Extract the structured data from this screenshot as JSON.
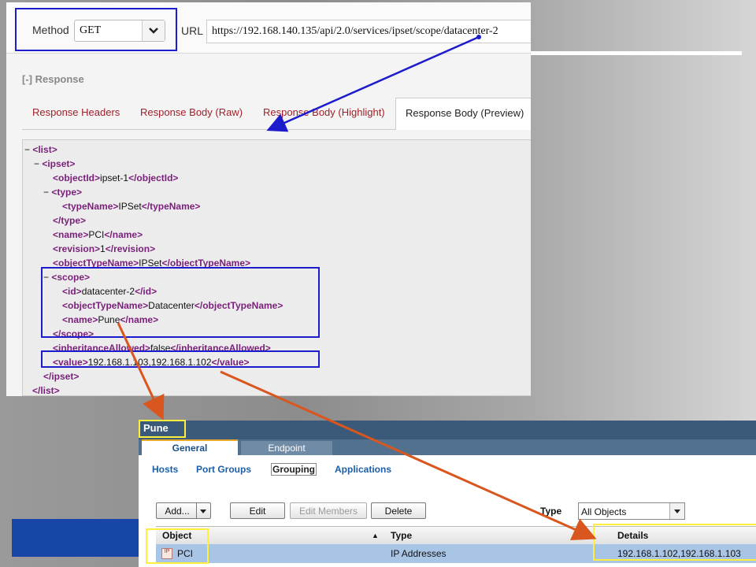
{
  "request": {
    "method_label": "Method",
    "method_value": "GET",
    "url_label": "URL",
    "url_value": "https://192.168.140.135/api/2.0/services/ipset/scope/datacenter-2"
  },
  "response": {
    "section_label": "[-] Response",
    "tabs": [
      {
        "label": "Response Headers"
      },
      {
        "label": "Response Body (Raw)"
      },
      {
        "label": "Response Body (Highlight)"
      },
      {
        "label": "Response Body (Preview)"
      }
    ],
    "xml_lines": [
      {
        "pre": "− ",
        "o": "<list>",
        "t": "",
        "c": ""
      },
      {
        "pre": "− ",
        "o": "<ipset>",
        "t": "",
        "c": ""
      },
      {
        "pre": "",
        "o": "<objectId>",
        "t": "ipset-1",
        "c": "</objectId>"
      },
      {
        "pre": "− ",
        "o": "<type>",
        "t": "",
        "c": ""
      },
      {
        "pre": "",
        "o": "<typeName>",
        "t": "IPSet",
        "c": "</typeName>"
      },
      {
        "pre": "",
        "o": "</type>",
        "t": "",
        "c": ""
      },
      {
        "pre": "",
        "o": "<name>",
        "t": "PCI",
        "c": "</name>"
      },
      {
        "pre": "",
        "o": "<revision>",
        "t": "1",
        "c": "</revision>"
      },
      {
        "pre": "",
        "o": "<objectTypeName>",
        "t": "IPSet",
        "c": "</objectTypeName>"
      },
      {
        "pre": "− ",
        "o": "<scope>",
        "t": "",
        "c": ""
      },
      {
        "pre": "",
        "o": "<id>",
        "t": "datacenter-2",
        "c": "</id>"
      },
      {
        "pre": "",
        "o": "<objectTypeName>",
        "t": "Datacenter",
        "c": "</objectTypeName>"
      },
      {
        "pre": "",
        "o": "<name>",
        "t": "Pune",
        "c": "</name>"
      },
      {
        "pre": "",
        "o": "</scope>",
        "t": "",
        "c": ""
      },
      {
        "pre": "",
        "o": "<inheritanceAllowed>",
        "t": "false",
        "c": "</inheritanceAllowed>"
      },
      {
        "pre": "",
        "o": "<value>",
        "t": "192.168.1.103,192.168.1.102",
        "c": "</value>"
      },
      {
        "pre": "",
        "o": "</ipset>",
        "t": "",
        "c": ""
      },
      {
        "pre": "",
        "o": "</list>",
        "t": "",
        "c": ""
      }
    ]
  },
  "vsphere": {
    "object_title": "Pune",
    "tabs": [
      "General",
      "Endpoint"
    ],
    "sublinks": [
      "Hosts",
      "Port Groups",
      "Grouping",
      "Applications"
    ],
    "buttons": [
      "Add...",
      "Edit",
      "Edit Members",
      "Delete"
    ],
    "type_label": "Type",
    "type_value": "All Objects",
    "columns": [
      "Object",
      "Type",
      "Details"
    ],
    "sort_indicator": "▲",
    "rows": [
      {
        "object": "PCI",
        "type": "IP Addresses",
        "details": "192.168.1.102,192.168.1.103",
        "icon_label": "IP"
      }
    ]
  },
  "colors": {
    "highlight_blue": "#1c1ccc",
    "highlight_yellow": "#ffef3c",
    "arrow_blue": "#1c1ccc",
    "arrow_orange": "#d9561f",
    "xml_tag": "#7a1f7a"
  },
  "icons": [
    "chevron-down-icon",
    "ipset-icon"
  ]
}
